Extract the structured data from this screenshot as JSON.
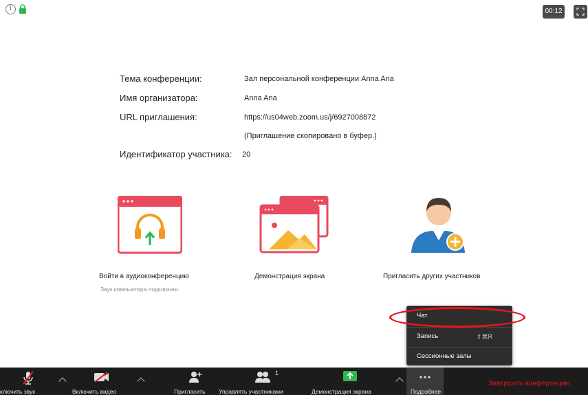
{
  "topbar": {
    "timer": "00:12"
  },
  "meeting": {
    "topic_label": "Тема конференции:",
    "topic_value": "Зал персональной конференции Anna Ana",
    "host_label": "Имя организатора:",
    "host_value": "Anna Ana",
    "url_label": "URL приглашения:",
    "url_value": "https://us04web.zoom.us/j/6927008872",
    "copied_note": "(Приглашение скопировано в буфер.)",
    "participant_id_label": "Идентификатор участника:",
    "participant_id_value": "20"
  },
  "actions": {
    "audio_label": "Войти в аудиоконференцию",
    "audio_sub": "Звук компьютера подключен",
    "share_label": "Демонстрация экрана",
    "invite_label": "Пригласить других участников"
  },
  "more_menu": {
    "chat": "Чат",
    "record": "Запись",
    "record_shortcut": "⇧⌘R",
    "breakout": "Сессионные залы"
  },
  "toolbar": {
    "mute": "ключить звук",
    "video": "Включить видео",
    "invite": "Пригласить",
    "participants": "Управлять участниками",
    "participants_count": "1",
    "share": "Демонстрация экрана",
    "more": "Подробнее",
    "end": "Завершить конференцию"
  },
  "colors": {
    "accent_red": "#e8141c",
    "share_green": "#2db84d",
    "toolbar_bg": "#1c1c1c"
  }
}
